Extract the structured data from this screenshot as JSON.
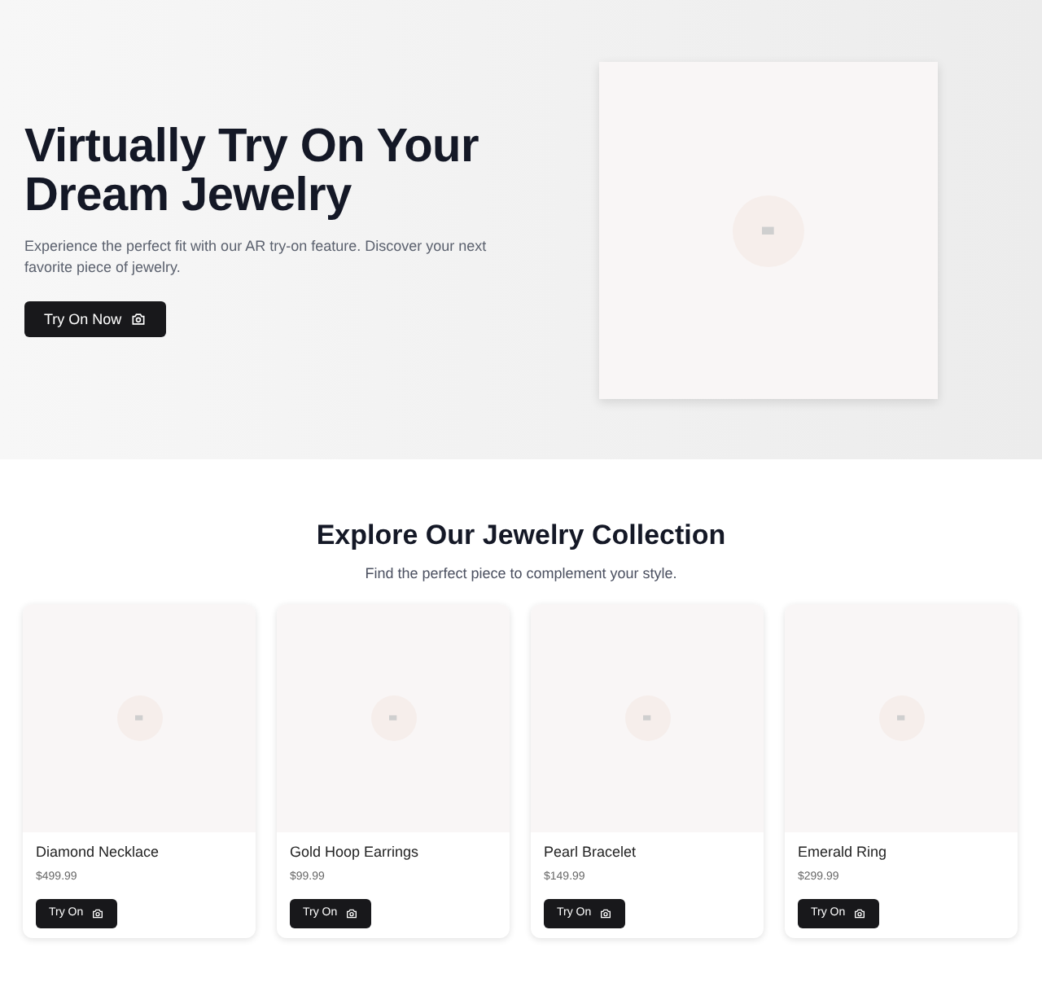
{
  "hero": {
    "title": "Virtually Try On Your Dream Jewelry",
    "description": "Experience the perfect fit with our AR try-on feature. Discover your next favorite piece of jewelry.",
    "button": "Try On Now"
  },
  "collection": {
    "title": "Explore Our Jewelry Collection",
    "subtitle": "Find the perfect piece to complement your style.",
    "products": [
      {
        "name": "Diamond Necklace",
        "price": "$499.99",
        "button": "Try On"
      },
      {
        "name": "Gold Hoop Earrings",
        "price": "$99.99",
        "button": "Try On"
      },
      {
        "name": "Pearl Bracelet",
        "price": "$149.99",
        "button": "Try On"
      },
      {
        "name": "Emerald Ring",
        "price": "$299.99",
        "button": "Try On"
      }
    ]
  }
}
